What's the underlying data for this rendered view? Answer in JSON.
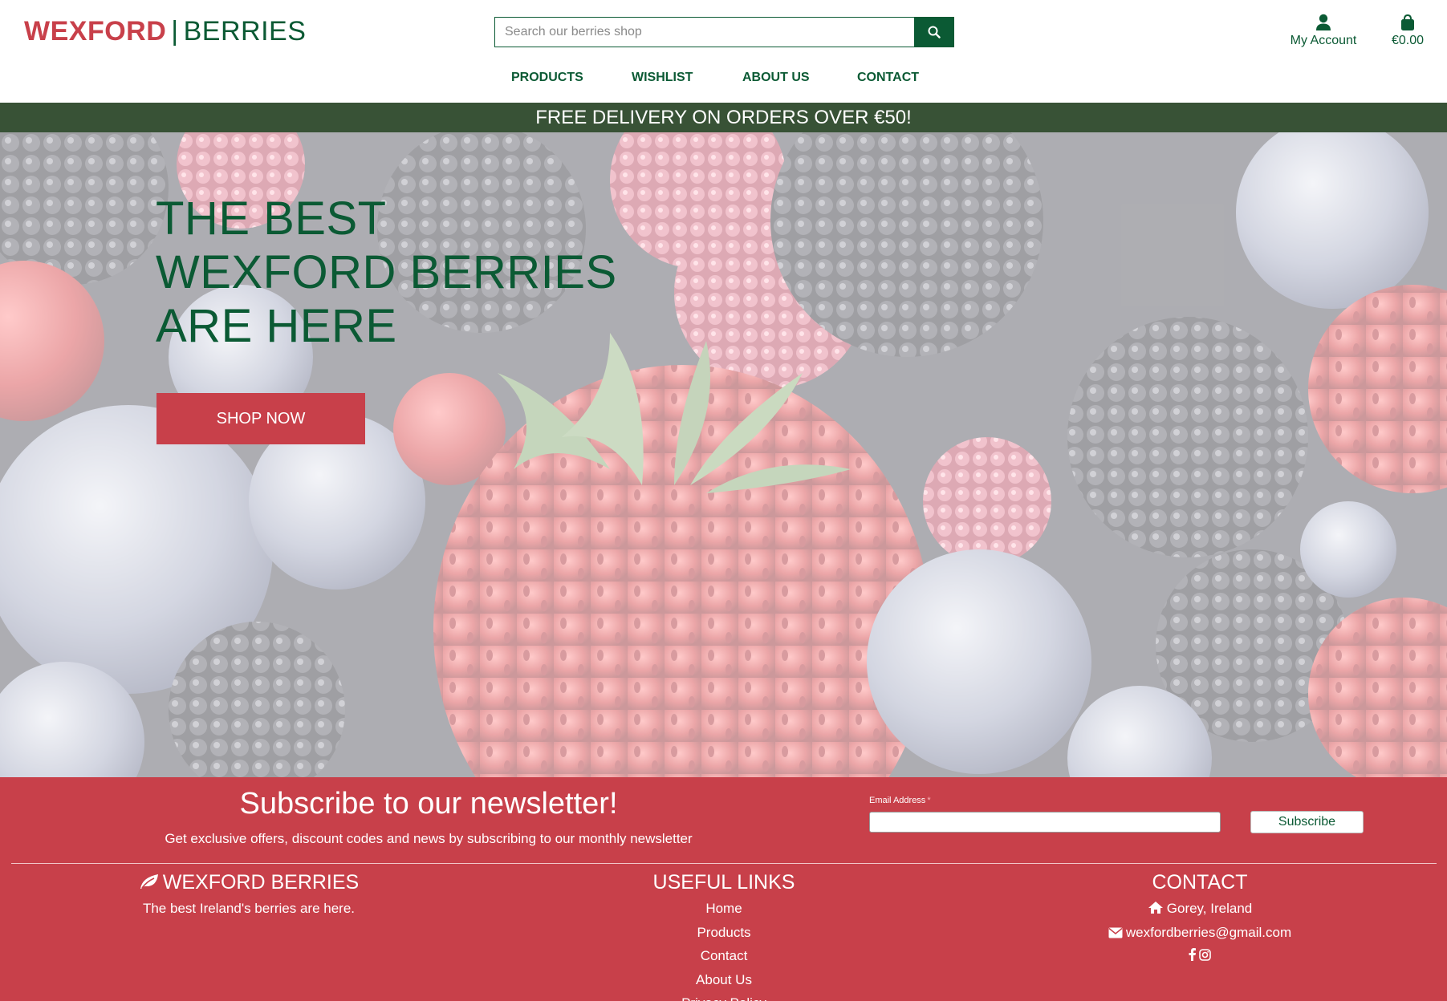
{
  "header": {
    "logo_part1": "WEXFORD",
    "logo_separator": "|",
    "logo_part2": "BERRIES",
    "search_placeholder": "Search our berries shop",
    "account_label": "My Account",
    "bag_total": "€0.00"
  },
  "nav": [
    "PRODUCTS",
    "WISHLIST",
    "ABOUT US",
    "CONTACT"
  ],
  "banner": {
    "text": "FREE DELIVERY ON ORDERS OVER €50!"
  },
  "hero": {
    "headline": [
      "THE BEST",
      "WEXFORD BERRIES",
      "ARE HERE"
    ],
    "cta": "SHOP NOW"
  },
  "newsletter": {
    "title": "Subscribe to our newsletter!",
    "subtitle": "Get exclusive offers, discount codes and news by subscribing to our monthly newsletter",
    "email_label": "Email Address",
    "required_mark": "*",
    "button": "Subscribe"
  },
  "footer": {
    "brand": {
      "title": "WEXFORD BERRIES",
      "tagline": "The best Ireland's berries are here."
    },
    "links": {
      "title": "USEFUL LINKS",
      "items": [
        "Home",
        "Products",
        "Contact",
        "About Us",
        "Privacy Policy"
      ]
    },
    "contact": {
      "title": "CONTACT",
      "address": "Gorey, Ireland",
      "email": "wexfordberries@gmail.com"
    }
  },
  "icons": {
    "search": "search-icon",
    "account": "user-icon",
    "bag": "shopping-bag-icon",
    "leaf": "leaf-icon",
    "home": "home-icon",
    "envelope": "envelope-icon",
    "facebook": "facebook-icon",
    "instagram": "instagram-icon"
  },
  "colors": {
    "brand_red": "#c8404a",
    "brand_green": "#0b5a34",
    "banner_green": "#385236",
    "white": "#ffffff"
  }
}
